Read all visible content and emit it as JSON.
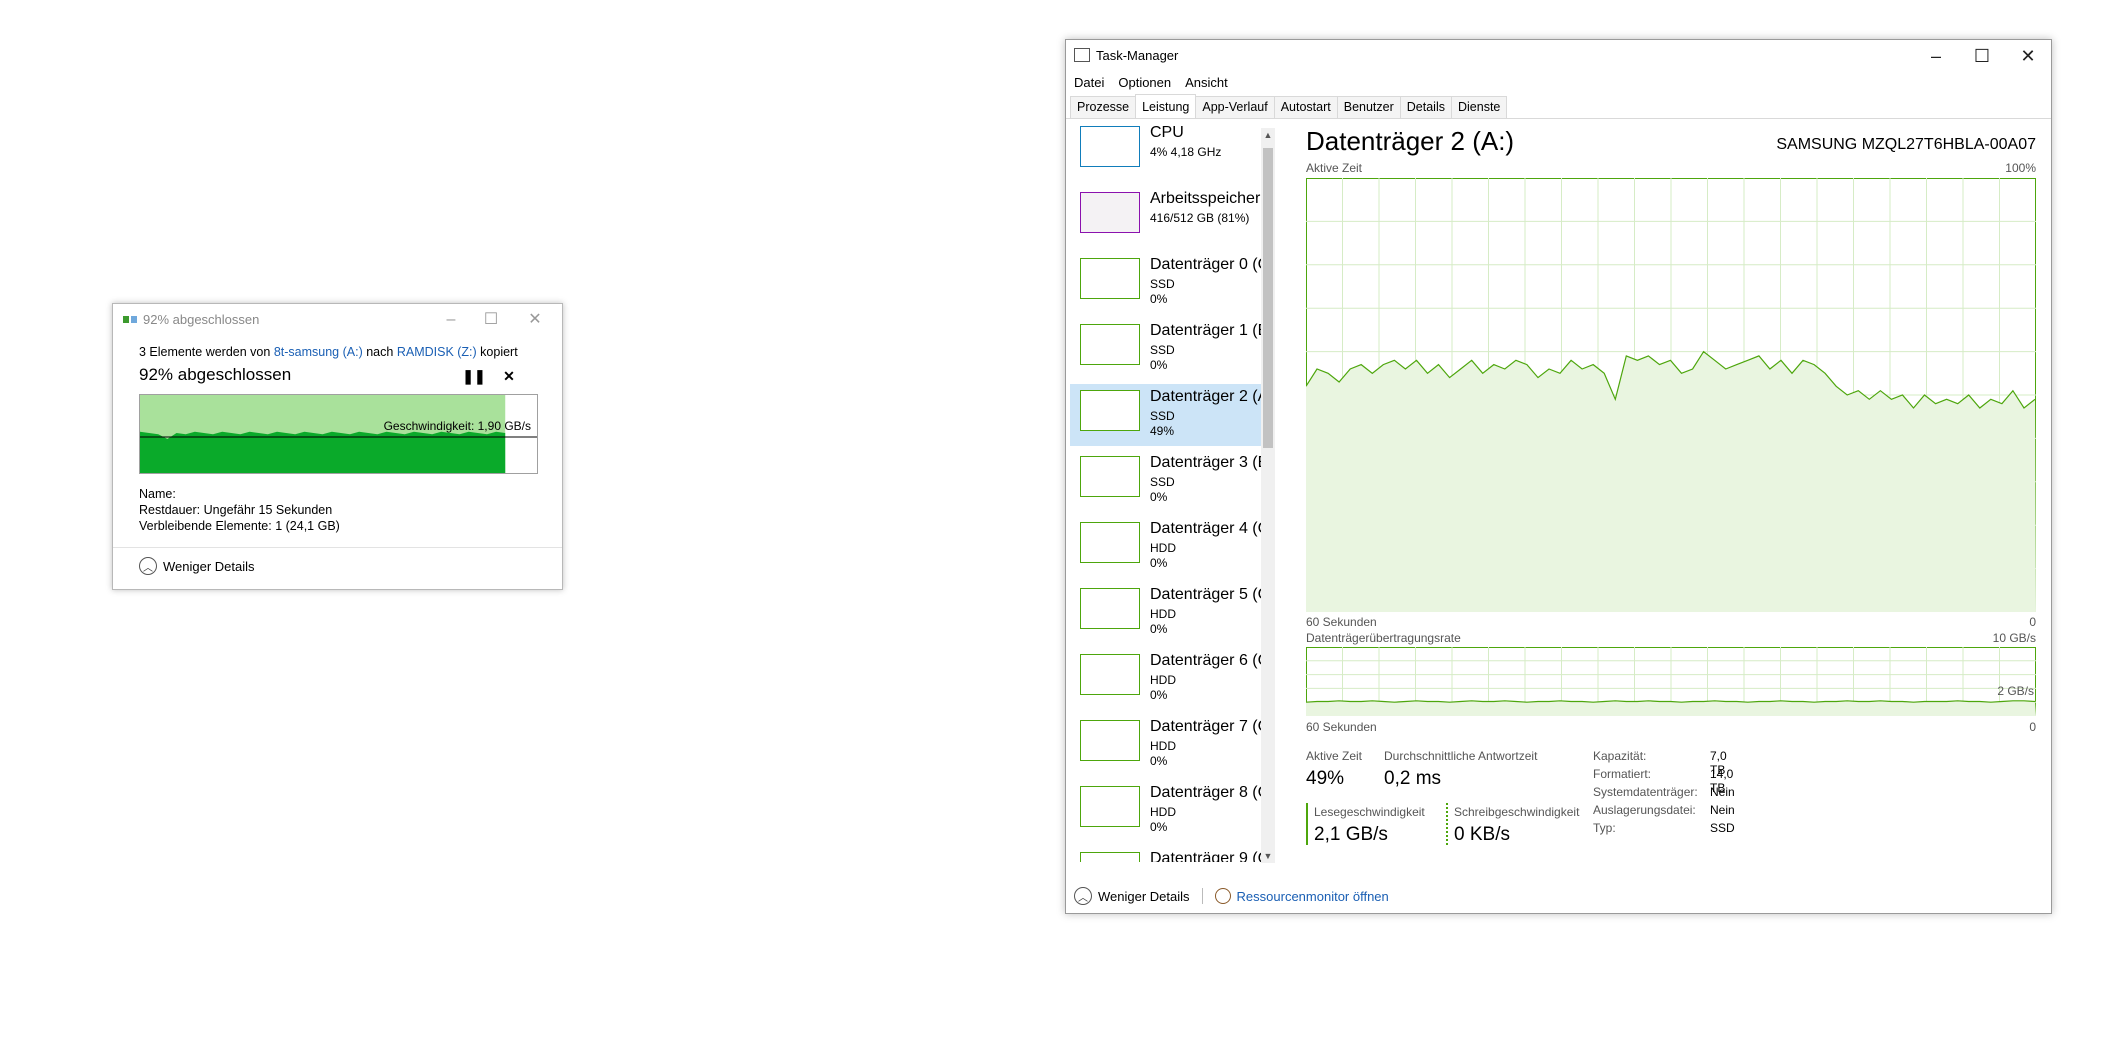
{
  "copy_dialog": {
    "title": "92% abgeschlossen",
    "desc_prefix": "3 Elemente werden von",
    "source": "8t-samsung (A:)",
    "desc_mid": "nach",
    "target": "RAMDISK (Z:)",
    "desc_suffix": "kopiert",
    "progress_text": "92% abgeschlossen",
    "progress": 0.92,
    "speed_label": "Geschwindigkeit: 1,90 GB/s",
    "name_label": "Name:",
    "remaining_label": "Restdauer:",
    "remaining_value": "Ungefähr 15 Sekunden",
    "items_label": "Verbleibende Elemente:",
    "items_value": "1 (24,1 GB)",
    "less_details": "Weniger Details",
    "pause_icon": "pause-icon",
    "cancel_icon": "close-icon"
  },
  "task_manager": {
    "title": "Task-Manager",
    "menu": [
      "Datei",
      "Optionen",
      "Ansicht"
    ],
    "tabs": [
      "Prozesse",
      "Leistung",
      "App-Verlauf",
      "Autostart",
      "Benutzer",
      "Details",
      "Dienste"
    ],
    "active_tab": "Leistung",
    "devices": [
      {
        "name": "CPU",
        "l2": "4% 4,18 GHz",
        "l3": "",
        "color": "#117dbb"
      },
      {
        "name": "Arbeitsspeicher",
        "l2": "416/512 GB (81%)",
        "l3": "",
        "color": "#8b12ae"
      },
      {
        "name": "Datenträger 0 (C",
        "l2": "SSD",
        "l3": "0%",
        "color": "#4da60c"
      },
      {
        "name": "Datenträger 1 (E",
        "l2": "SSD",
        "l3": "0%",
        "color": "#4da60c"
      },
      {
        "name": "Datenträger 2 (A",
        "l2": "SSD",
        "l3": "49%",
        "color": "#4da60c"
      },
      {
        "name": "Datenträger 3 (E",
        "l2": "SSD",
        "l3": "0%",
        "color": "#4da60c"
      },
      {
        "name": "Datenträger 4 (C",
        "l2": "HDD",
        "l3": "0%",
        "color": "#4da60c"
      },
      {
        "name": "Datenträger 5 (C",
        "l2": "HDD",
        "l3": "0%",
        "color": "#4da60c"
      },
      {
        "name": "Datenträger 6 (C",
        "l2": "HDD",
        "l3": "0%",
        "color": "#4da60c"
      },
      {
        "name": "Datenträger 7 (C",
        "l2": "HDD",
        "l3": "0%",
        "color": "#4da60c"
      },
      {
        "name": "Datenträger 8 (C",
        "l2": "HDD",
        "l3": "0%",
        "color": "#4da60c"
      },
      {
        "name": "Datenträger 9 (C",
        "l2": "",
        "l3": "",
        "color": "#4da60c"
      }
    ],
    "selected_device": 4,
    "main": {
      "title": "Datenträger 2 (A:)",
      "model": "SAMSUNG MZQL27T6HBLA-00A07",
      "active_time_label": "Aktive Zeit",
      "active_time_max": "100%",
      "x_label": "60 Sekunden",
      "x_zero": "0",
      "rate_label": "Datenträgerübertragungsrate",
      "rate_max": "10 GB/s",
      "rate_mid": "2 GB/s",
      "stats": {
        "active_time_label": "Aktive Zeit",
        "active_time_value": "49%",
        "resp_label": "Durchschnittliche Antwortzeit",
        "resp_value": "0,2 ms",
        "read_label": "Lesegeschwindigkeit",
        "read_value": "2,1 GB/s",
        "write_label": "Schreibgeschwindigkeit",
        "write_value": "0 KB/s"
      },
      "props": [
        {
          "k": "Kapazität:",
          "v": "7,0 TB"
        },
        {
          "k": "Formatiert:",
          "v": "14,0 TB"
        },
        {
          "k": "Systemdatenträger:",
          "v": "Nein"
        },
        {
          "k": "Auslagerungsdatei:",
          "v": "Nein"
        },
        {
          "k": "Typ:",
          "v": "SSD"
        }
      ]
    },
    "less_details": "Weniger Details",
    "resmon": "Ressourcenmonitor öffnen"
  },
  "chart_data": [
    {
      "type": "area",
      "title": "Aktive Zeit",
      "ylim": [
        0,
        100
      ],
      "x_range": "60 Sekunden",
      "values": [
        52,
        56,
        55,
        53,
        56,
        57,
        55,
        57,
        58,
        56,
        58,
        55,
        57,
        54,
        56,
        58,
        55,
        57,
        56,
        58,
        57,
        54,
        56,
        55,
        58,
        56,
        57,
        55,
        49,
        59,
        58,
        59,
        57,
        58,
        55,
        56,
        60,
        58,
        56,
        57,
        58,
        59,
        56,
        58,
        55,
        58,
        57,
        55,
        52,
        50,
        51,
        49,
        51,
        49,
        50,
        47,
        50,
        48,
        49,
        48,
        50,
        47,
        49,
        48,
        51,
        47,
        49
      ]
    },
    {
      "type": "area",
      "title": "Datenträgerübertragungsrate",
      "ylim": [
        0,
        10
      ],
      "unit": "GB/s",
      "values": [
        2.0,
        2.1,
        2.1,
        2.2,
        2.1,
        2.1,
        2.2,
        2.1,
        2.0,
        2.1,
        2.2,
        2.1,
        2.1,
        2.0,
        2.1,
        2.2,
        2.1,
        2.1,
        2.2,
        2.1,
        2.0,
        2.1,
        2.1,
        2.2,
        2.1,
        2.1,
        2.0,
        2.1,
        2.2,
        2.1,
        2.1,
        2.2,
        2.1,
        2.1,
        2.0,
        2.1,
        2.1,
        2.2,
        2.1,
        2.1,
        2.0,
        2.1,
        2.1,
        2.2,
        2.1,
        2.1,
        2.0,
        2.1,
        2.1,
        2.2,
        2.1,
        2.1,
        2.2,
        2.1,
        2.1,
        2.0,
        2.1,
        2.1,
        2.1,
        2.2,
        2.1,
        2.1,
        2.0,
        2.1,
        2.2,
        2.2,
        2.1
      ]
    }
  ]
}
